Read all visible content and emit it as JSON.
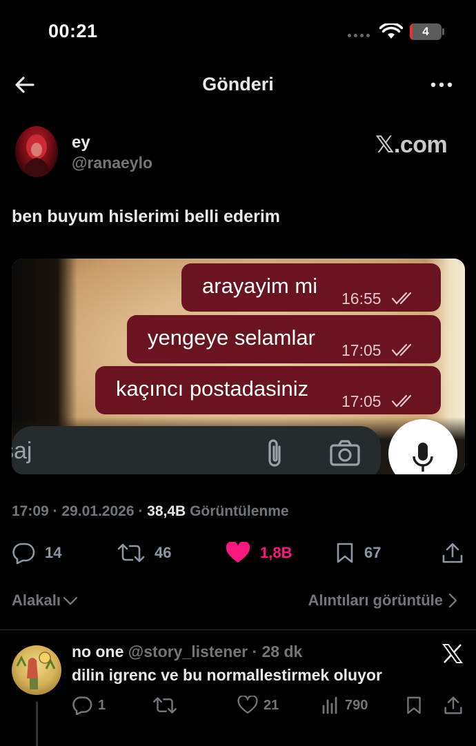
{
  "status_bar": {
    "time": "00:21",
    "battery": "4",
    "battery_fraction": 0.08
  },
  "header": {
    "title": "Gönderi"
  },
  "post": {
    "author_name": "ey",
    "author_handle": "@ranaeylo",
    "watermark": "𝕏.com",
    "text": "ben buyum hislerimi belli ederim",
    "media": {
      "messages": [
        {
          "text": "arayayim mi",
          "time": "16:55"
        },
        {
          "text": "yengeye selamlar",
          "time": "17:05"
        },
        {
          "text": "kaçıncı postadasiniz",
          "time": "17:05"
        }
      ],
      "input_placeholder": "saj"
    },
    "meta": {
      "time": "17:09",
      "date": "29.01.2026",
      "views_count": "38,4B",
      "views_label": "Görüntülenme"
    },
    "actions": {
      "replies": "14",
      "reposts": "46",
      "likes": "1,8B",
      "bookmarks": "67"
    }
  },
  "filters": {
    "sort_label": "Alakalı",
    "quotes_label": "Alıntıları görüntüle"
  },
  "reply": {
    "name": "no one",
    "handle": "@story_listener",
    "age": "28 dk",
    "text": "dilin igrenc ve bu normallestirmek oluyor",
    "actions": {
      "replies": "1",
      "reposts": "",
      "likes": "21",
      "views": "790"
    }
  },
  "colors": {
    "accent_like": "#f91880",
    "bubble": "#6a1422",
    "muted": "#71767b"
  }
}
